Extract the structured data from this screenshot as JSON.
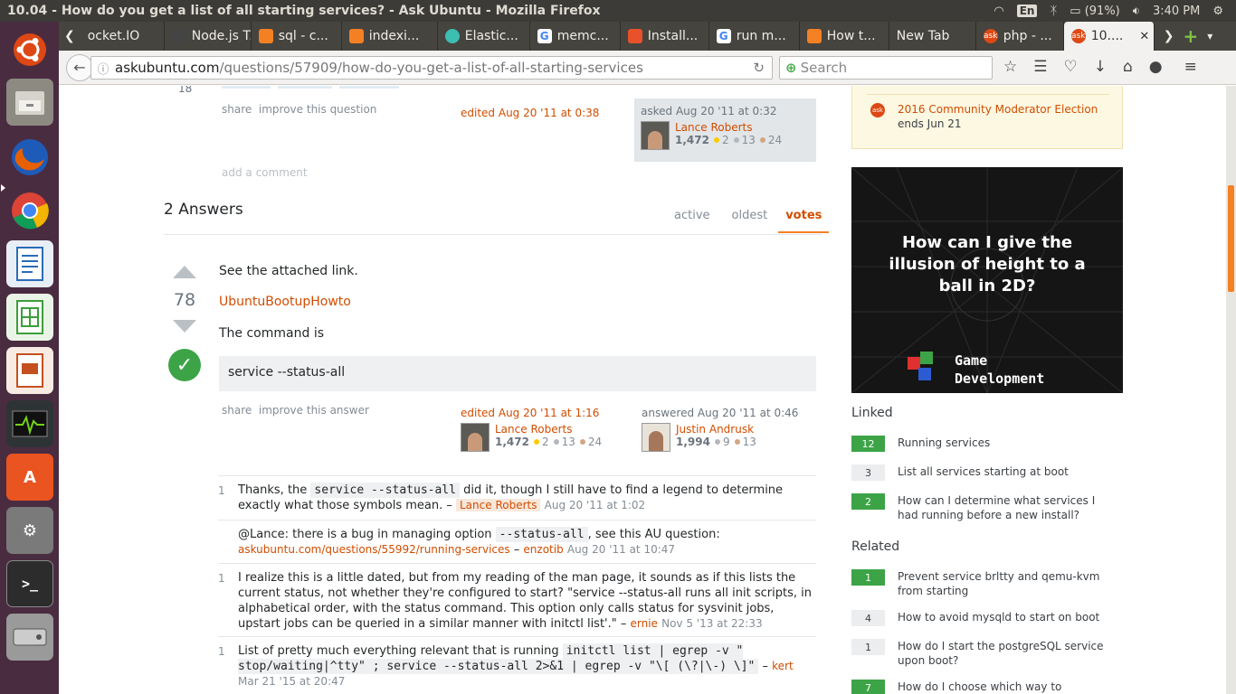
{
  "window_title": "10.04 - How do you get a list of all starting services? - Ask Ubuntu - Mozilla Firefox",
  "indicators": {
    "keyboard": "En",
    "battery": "(91%)",
    "clock": "3:40 PM"
  },
  "tabs": [
    {
      "label": "ocket.IO",
      "icon_color": "#ffffff"
    },
    {
      "label": "Node.js T...",
      "icon_color": "#e8e8e8"
    },
    {
      "label": "sql - c...",
      "icon_color": "#f48024"
    },
    {
      "label": "indexi...",
      "icon_color": "#f48024"
    },
    {
      "label": "Elastic...",
      "icon_color": "#3cbeb1"
    },
    {
      "label": "memc...",
      "icon_color": "#4285f4"
    },
    {
      "label": "Install...",
      "icon_color": "#e8512a"
    },
    {
      "label": "run m...",
      "icon_color": "#4285f4"
    },
    {
      "label": "How t...",
      "icon_color": "#f48024"
    },
    {
      "label": "New Tab",
      "icon_color": ""
    },
    {
      "label": "php - ...",
      "icon_color": "#dd4814"
    },
    {
      "label": "10....",
      "icon_color": "#dd4814",
      "active": true
    }
  ],
  "nav": {
    "url_host": "askubuntu.com",
    "url_path": "/questions/57909/how-do-you-get-a-list-of-all-starting-services",
    "search_placeholder": "Search"
  },
  "question": {
    "score_partial": "18",
    "share": "share",
    "improve": "improve this question",
    "edited": "edited Aug 20 '11 at 0:38",
    "asked": "asked Aug 20 '11 at 0:32",
    "owner": {
      "name": "Lance Roberts",
      "rep": "1,472",
      "gold": "2",
      "silver": "13",
      "bronze": "24"
    },
    "add_comment": "add a comment"
  },
  "answers_header": {
    "count": "2 Answers",
    "sort_tabs": [
      "active",
      "oldest",
      "votes"
    ],
    "active_sort": "votes"
  },
  "answer": {
    "score": "78",
    "p1": "See the attached link.",
    "link": "UbuntuBootupHowto",
    "p2": "The command is",
    "code": "service --status-all",
    "share": "share",
    "improve": "improve this answer",
    "edited": "edited Aug 20 '11 at 1:16",
    "editor": {
      "name": "Lance Roberts",
      "rep": "1,472",
      "gold": "2",
      "silver": "13",
      "bronze": "24"
    },
    "answered": "answered Aug 20 '11 at 0:46",
    "author": {
      "name": "Justin Andrusk",
      "rep": "1,994",
      "silver": "9",
      "bronze": "13"
    }
  },
  "comments": [
    {
      "score": "1",
      "pre": "Thanks, the ",
      "code": "service --status-all",
      "post": " did it, though I still have to find a legend to determine exactly what those symbols mean. – ",
      "user": "Lance Roberts",
      "date": "Aug 20 '11 at 1:02"
    },
    {
      "score": "",
      "pre": "@Lance: there is a bug in managing option ",
      "code": "--status-all",
      "post": ", see this AU question: ",
      "link": "askubuntu.com/questions/55992/running-services",
      "sep": " – ",
      "user": "enzotib",
      "date": "Aug 20 '11 at 10:47"
    },
    {
      "score": "1",
      "text": "I realize this is a little dated, but from my reading of the man page, it sounds as if this lists the current status, not whether they're configured to start? \"service --status-all runs all init scripts, in alphabetical order, with the status command. This option only calls status for sysvinit jobs, upstart jobs can be queried in a similar manner with initctl list'.\" – ",
      "user": "ernie",
      "date": "Nov 5 '13 at 22:33"
    },
    {
      "score": "1",
      "pre": "List of pretty much everything relevant that is running ",
      "code": "initctl list | egrep -v \" stop/waiting|^tty\" ; service --status-all 2>&1 | egrep -v \"\\[ (\\?|\\-) \\]\"",
      "post": " – ",
      "user": "kert",
      "date": "Mar 21 '15 at 20:47"
    }
  ],
  "sidebar": {
    "community_bulletin": {
      "title": "2016 Community Moderator Election",
      "sub": "ends Jun 21"
    },
    "ad": {
      "headline": "How can I give the illusion of height to a ball in 2D?",
      "brand_line1": "Game",
      "brand_line2": "Development"
    },
    "linked_title": "Linked",
    "linked": [
      {
        "count": "12",
        "accepted": true,
        "title": "Running services"
      },
      {
        "count": "3",
        "accepted": false,
        "title": "List all services starting at boot"
      },
      {
        "count": "2",
        "accepted": true,
        "title": "How can I determine what services I had running before a new install?"
      }
    ],
    "related_title": "Related",
    "related": [
      {
        "count": "1",
        "accepted": true,
        "title": "Prevent service brltty and qemu-kvm from starting"
      },
      {
        "count": "4",
        "accepted": false,
        "title": "How to avoid mysqld to start on boot"
      },
      {
        "count": "1",
        "accepted": false,
        "title": "How do I start the postgreSQL service upon boot?"
      },
      {
        "count": "7",
        "accepted": true,
        "title": "How do I choose which way to enable/disable,"
      }
    ]
  },
  "launcher_apps": [
    {
      "name": "ubuntu-dash",
      "color": "#dd4814"
    },
    {
      "name": "files",
      "color": "#8d8a82"
    },
    {
      "name": "firefox",
      "color": "#e66000"
    },
    {
      "name": "chrome",
      "color": "#4285f4"
    },
    {
      "name": "writer",
      "color": "#2a6cb6"
    },
    {
      "name": "calc",
      "color": "#3c9e3c"
    },
    {
      "name": "impress",
      "color": "#c5501f"
    },
    {
      "name": "system-monitor",
      "color": "#2e3436"
    },
    {
      "name": "software-center",
      "color": "#e95420"
    },
    {
      "name": "settings",
      "color": "#7a7a7a"
    },
    {
      "name": "terminal",
      "color": "#2c2c2c"
    },
    {
      "name": "disks",
      "color": "#9a9a9a"
    }
  ]
}
